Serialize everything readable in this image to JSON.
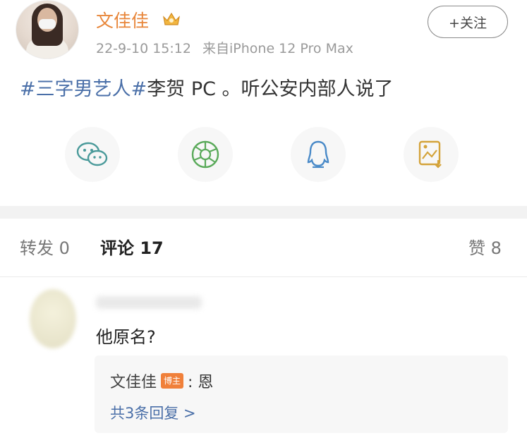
{
  "post": {
    "username": "文佳佳",
    "crown_icon": "crown-icon",
    "time": "22-9-10 15:12",
    "source": "来自iPhone 12 Pro Max",
    "follow_label": "+关注",
    "hashtag1": "#三字男艺人#",
    "text_rest": "李贺 PC 。听公安内部人说了"
  },
  "share": {
    "items": [
      "wechat-icon",
      "moments-icon",
      "qq-icon",
      "save-image-icon"
    ],
    "colors": {
      "wechat": "#4a9a9a",
      "moments": "#5aaa5a",
      "qq": "#4a8ac8",
      "image": "#d4a33a"
    }
  },
  "tabs": {
    "repost": "转发 0",
    "comment": "评论 17",
    "like": "赞 8"
  },
  "comment": {
    "text": "他原名?",
    "reply": {
      "author": "文佳佳",
      "badge": "博主",
      "content": ": 恩",
      "more": "共3条回复 >"
    }
  }
}
